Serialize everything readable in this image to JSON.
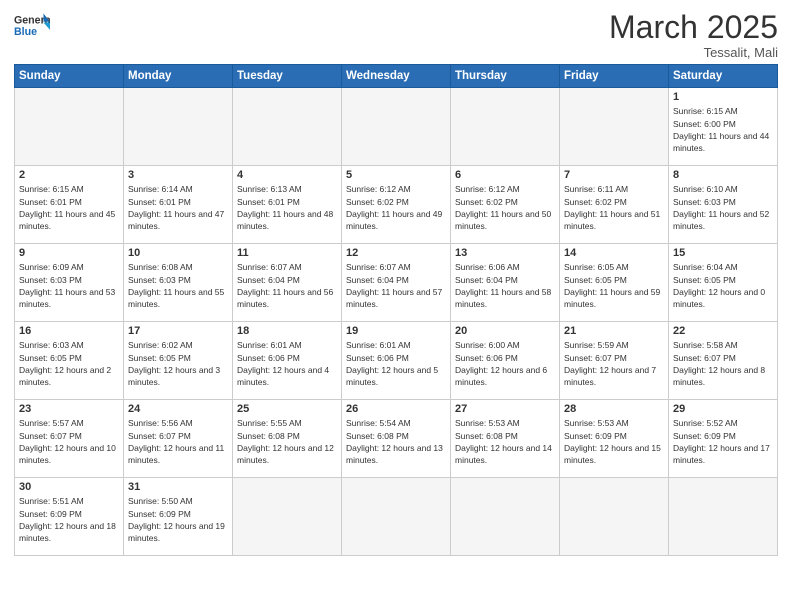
{
  "logo": {
    "text_general": "General",
    "text_blue": "Blue"
  },
  "title": "March 2025",
  "subtitle": "Tessalit, Mali",
  "header_days": [
    "Sunday",
    "Monday",
    "Tuesday",
    "Wednesday",
    "Thursday",
    "Friday",
    "Saturday"
  ],
  "weeks": [
    [
      {
        "day": "",
        "info": ""
      },
      {
        "day": "",
        "info": ""
      },
      {
        "day": "",
        "info": ""
      },
      {
        "day": "",
        "info": ""
      },
      {
        "day": "",
        "info": ""
      },
      {
        "day": "",
        "info": ""
      },
      {
        "day": "1",
        "info": "Sunrise: 6:15 AM\nSunset: 6:00 PM\nDaylight: 11 hours and 44 minutes."
      }
    ],
    [
      {
        "day": "2",
        "info": "Sunrise: 6:15 AM\nSunset: 6:01 PM\nDaylight: 11 hours and 45 minutes."
      },
      {
        "day": "3",
        "info": "Sunrise: 6:14 AM\nSunset: 6:01 PM\nDaylight: 11 hours and 47 minutes."
      },
      {
        "day": "4",
        "info": "Sunrise: 6:13 AM\nSunset: 6:01 PM\nDaylight: 11 hours and 48 minutes."
      },
      {
        "day": "5",
        "info": "Sunrise: 6:12 AM\nSunset: 6:02 PM\nDaylight: 11 hours and 49 minutes."
      },
      {
        "day": "6",
        "info": "Sunrise: 6:12 AM\nSunset: 6:02 PM\nDaylight: 11 hours and 50 minutes."
      },
      {
        "day": "7",
        "info": "Sunrise: 6:11 AM\nSunset: 6:02 PM\nDaylight: 11 hours and 51 minutes."
      },
      {
        "day": "8",
        "info": "Sunrise: 6:10 AM\nSunset: 6:03 PM\nDaylight: 11 hours and 52 minutes."
      }
    ],
    [
      {
        "day": "9",
        "info": "Sunrise: 6:09 AM\nSunset: 6:03 PM\nDaylight: 11 hours and 53 minutes."
      },
      {
        "day": "10",
        "info": "Sunrise: 6:08 AM\nSunset: 6:03 PM\nDaylight: 11 hours and 55 minutes."
      },
      {
        "day": "11",
        "info": "Sunrise: 6:07 AM\nSunset: 6:04 PM\nDaylight: 11 hours and 56 minutes."
      },
      {
        "day": "12",
        "info": "Sunrise: 6:07 AM\nSunset: 6:04 PM\nDaylight: 11 hours and 57 minutes."
      },
      {
        "day": "13",
        "info": "Sunrise: 6:06 AM\nSunset: 6:04 PM\nDaylight: 11 hours and 58 minutes."
      },
      {
        "day": "14",
        "info": "Sunrise: 6:05 AM\nSunset: 6:05 PM\nDaylight: 11 hours and 59 minutes."
      },
      {
        "day": "15",
        "info": "Sunrise: 6:04 AM\nSunset: 6:05 PM\nDaylight: 12 hours and 0 minutes."
      }
    ],
    [
      {
        "day": "16",
        "info": "Sunrise: 6:03 AM\nSunset: 6:05 PM\nDaylight: 12 hours and 2 minutes."
      },
      {
        "day": "17",
        "info": "Sunrise: 6:02 AM\nSunset: 6:05 PM\nDaylight: 12 hours and 3 minutes."
      },
      {
        "day": "18",
        "info": "Sunrise: 6:01 AM\nSunset: 6:06 PM\nDaylight: 12 hours and 4 minutes."
      },
      {
        "day": "19",
        "info": "Sunrise: 6:01 AM\nSunset: 6:06 PM\nDaylight: 12 hours and 5 minutes."
      },
      {
        "day": "20",
        "info": "Sunrise: 6:00 AM\nSunset: 6:06 PM\nDaylight: 12 hours and 6 minutes."
      },
      {
        "day": "21",
        "info": "Sunrise: 5:59 AM\nSunset: 6:07 PM\nDaylight: 12 hours and 7 minutes."
      },
      {
        "day": "22",
        "info": "Sunrise: 5:58 AM\nSunset: 6:07 PM\nDaylight: 12 hours and 8 minutes."
      }
    ],
    [
      {
        "day": "23",
        "info": "Sunrise: 5:57 AM\nSunset: 6:07 PM\nDaylight: 12 hours and 10 minutes."
      },
      {
        "day": "24",
        "info": "Sunrise: 5:56 AM\nSunset: 6:07 PM\nDaylight: 12 hours and 11 minutes."
      },
      {
        "day": "25",
        "info": "Sunrise: 5:55 AM\nSunset: 6:08 PM\nDaylight: 12 hours and 12 minutes."
      },
      {
        "day": "26",
        "info": "Sunrise: 5:54 AM\nSunset: 6:08 PM\nDaylight: 12 hours and 13 minutes."
      },
      {
        "day": "27",
        "info": "Sunrise: 5:53 AM\nSunset: 6:08 PM\nDaylight: 12 hours and 14 minutes."
      },
      {
        "day": "28",
        "info": "Sunrise: 5:53 AM\nSunset: 6:09 PM\nDaylight: 12 hours and 15 minutes."
      },
      {
        "day": "29",
        "info": "Sunrise: 5:52 AM\nSunset: 6:09 PM\nDaylight: 12 hours and 17 minutes."
      }
    ],
    [
      {
        "day": "30",
        "info": "Sunrise: 5:51 AM\nSunset: 6:09 PM\nDaylight: 12 hours and 18 minutes."
      },
      {
        "day": "31",
        "info": "Sunrise: 5:50 AM\nSunset: 6:09 PM\nDaylight: 12 hours and 19 minutes."
      },
      {
        "day": "",
        "info": ""
      },
      {
        "day": "",
        "info": ""
      },
      {
        "day": "",
        "info": ""
      },
      {
        "day": "",
        "info": ""
      },
      {
        "day": "",
        "info": ""
      }
    ]
  ]
}
